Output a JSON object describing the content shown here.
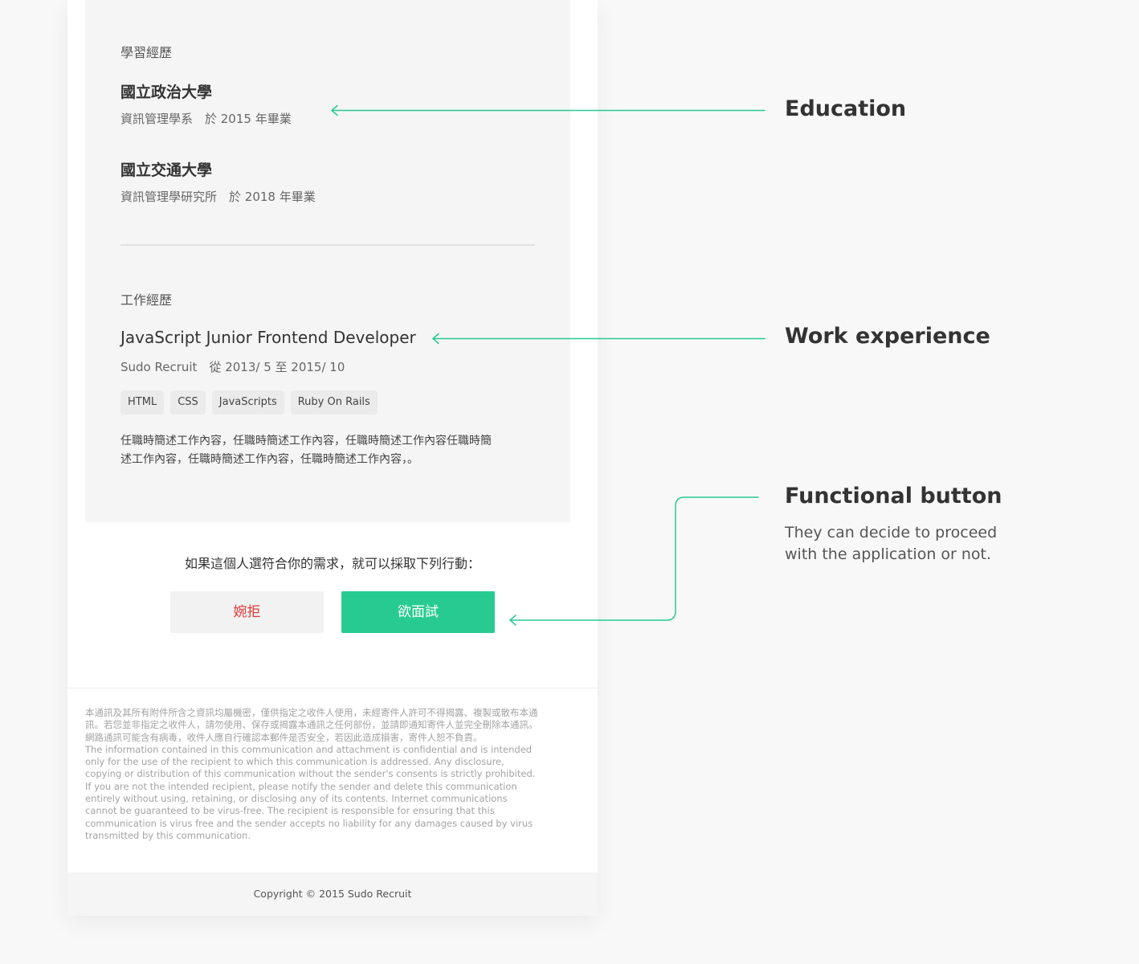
{
  "resume": {
    "education": {
      "title": "學習經歷",
      "schools": [
        {
          "name": "國立政治大學",
          "meta": "資訊管理學系　於 2015 年畢業"
        },
        {
          "name": "國立交通大學",
          "meta": "資訊管理學研究所　於 2018 年畢業"
        }
      ]
    },
    "work": {
      "title": "工作經歷",
      "job_title": "JavaScript Junior Frontend Developer",
      "company_period": "Sudo Recruit　從 2013/ 5  至 2015/ 10",
      "skills": [
        "HTML",
        "CSS",
        "JavaScripts",
        "Ruby On Rails"
      ],
      "description_line1": "任職時簡述工作內容，任職時簡述工作內容，任職時簡述工作內容任職時簡",
      "description_line2": "述工作內容，任職時簡述工作內容，任職時簡述工作內容，。"
    }
  },
  "actions": {
    "prompt": "如果這個人選符合你的需求，就可以採取下列行動：",
    "decline_label": "婉拒",
    "accept_label": "欲面試"
  },
  "disclaimer": {
    "zh": "本通訊及其所有附件所含之資訊均屬機密，僅供指定之收件人使用，未經寄件人許可不得揭露、複製或散布本通訊。若您並非指定之收件人，請勿使用、保存或揭露本通訊之任何部份，並請即通知寄件人並完全刪除本通訊。網路通訊可能含有病毒，收件人應自行確認本郵件是否安全，若因此造成損害，寄件人恕不負責。",
    "en": "The information contained in this communication and attachment is confidential and is intended only for the use of the recipient to which this communication is addressed. Any disclosure, copying or distribution of this communication without the sender's consents is strictly prohibited. If you are not the intended recipient, please notify the sender and delete this communication entirely without using, retaining, or disclosing any of its contents. Internet communications cannot be guaranteed to be virus-free. The recipient is responsible for ensuring that this communication is virus free and the sender accepts no liability for any damages caused by virus transmitted by this communication."
  },
  "footer": {
    "copyright": "Copyright © 2015 Sudo Recruit"
  },
  "annotations": {
    "education": "Education",
    "work": "Work experience",
    "button_title": "Functional button",
    "button_desc": "They can decide to proceed with the application or not."
  },
  "colors": {
    "accent": "#27cb91",
    "decline_text": "#e23a3a",
    "panel_bg": "#f5f5f5",
    "page_bg": "#f8f8f8"
  }
}
